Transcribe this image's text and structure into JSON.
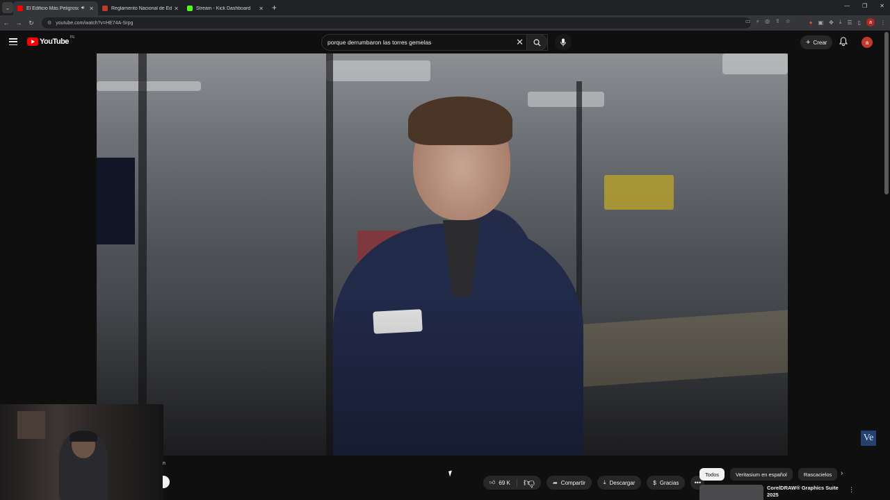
{
  "browser": {
    "tabs": [
      {
        "title": "El Edificio Más Peligroso del",
        "favicon_color": "#ff0000",
        "active": true,
        "audio": true
      },
      {
        "title": "Reglamento Nacional de Edifica",
        "favicon_color": "#c0392b",
        "active": false,
        "audio": false
      },
      {
        "title": "Stream - Kick Dashboard",
        "favicon_color": "#53fc18",
        "active": false,
        "audio": false
      }
    ],
    "url": "youtube.com/watch?v=HE74A-Srpg",
    "ext_avatar": "a"
  },
  "masthead": {
    "logo_text": "YouTube",
    "region": "PE",
    "search_value": "porque derrumbaron las torres gemelas",
    "create_label": "Crear",
    "account_initial": "a"
  },
  "player": {
    "watermark": "Ve"
  },
  "overlay": {
    "small_text": "n"
  },
  "actions": {
    "like_count": "69 K",
    "share_label": "Compartir",
    "download_label": "Descargar",
    "thanks_label": "Gracias"
  },
  "chips": [
    "Todos",
    "Veritasium en español",
    "Rascacielos"
  ],
  "suggestion": {
    "title": "CorelDRAW® Graphics Suite 2025"
  },
  "colors": {
    "brand": "#ff0000",
    "background": "#0f0f0f",
    "pill": "#272727"
  }
}
